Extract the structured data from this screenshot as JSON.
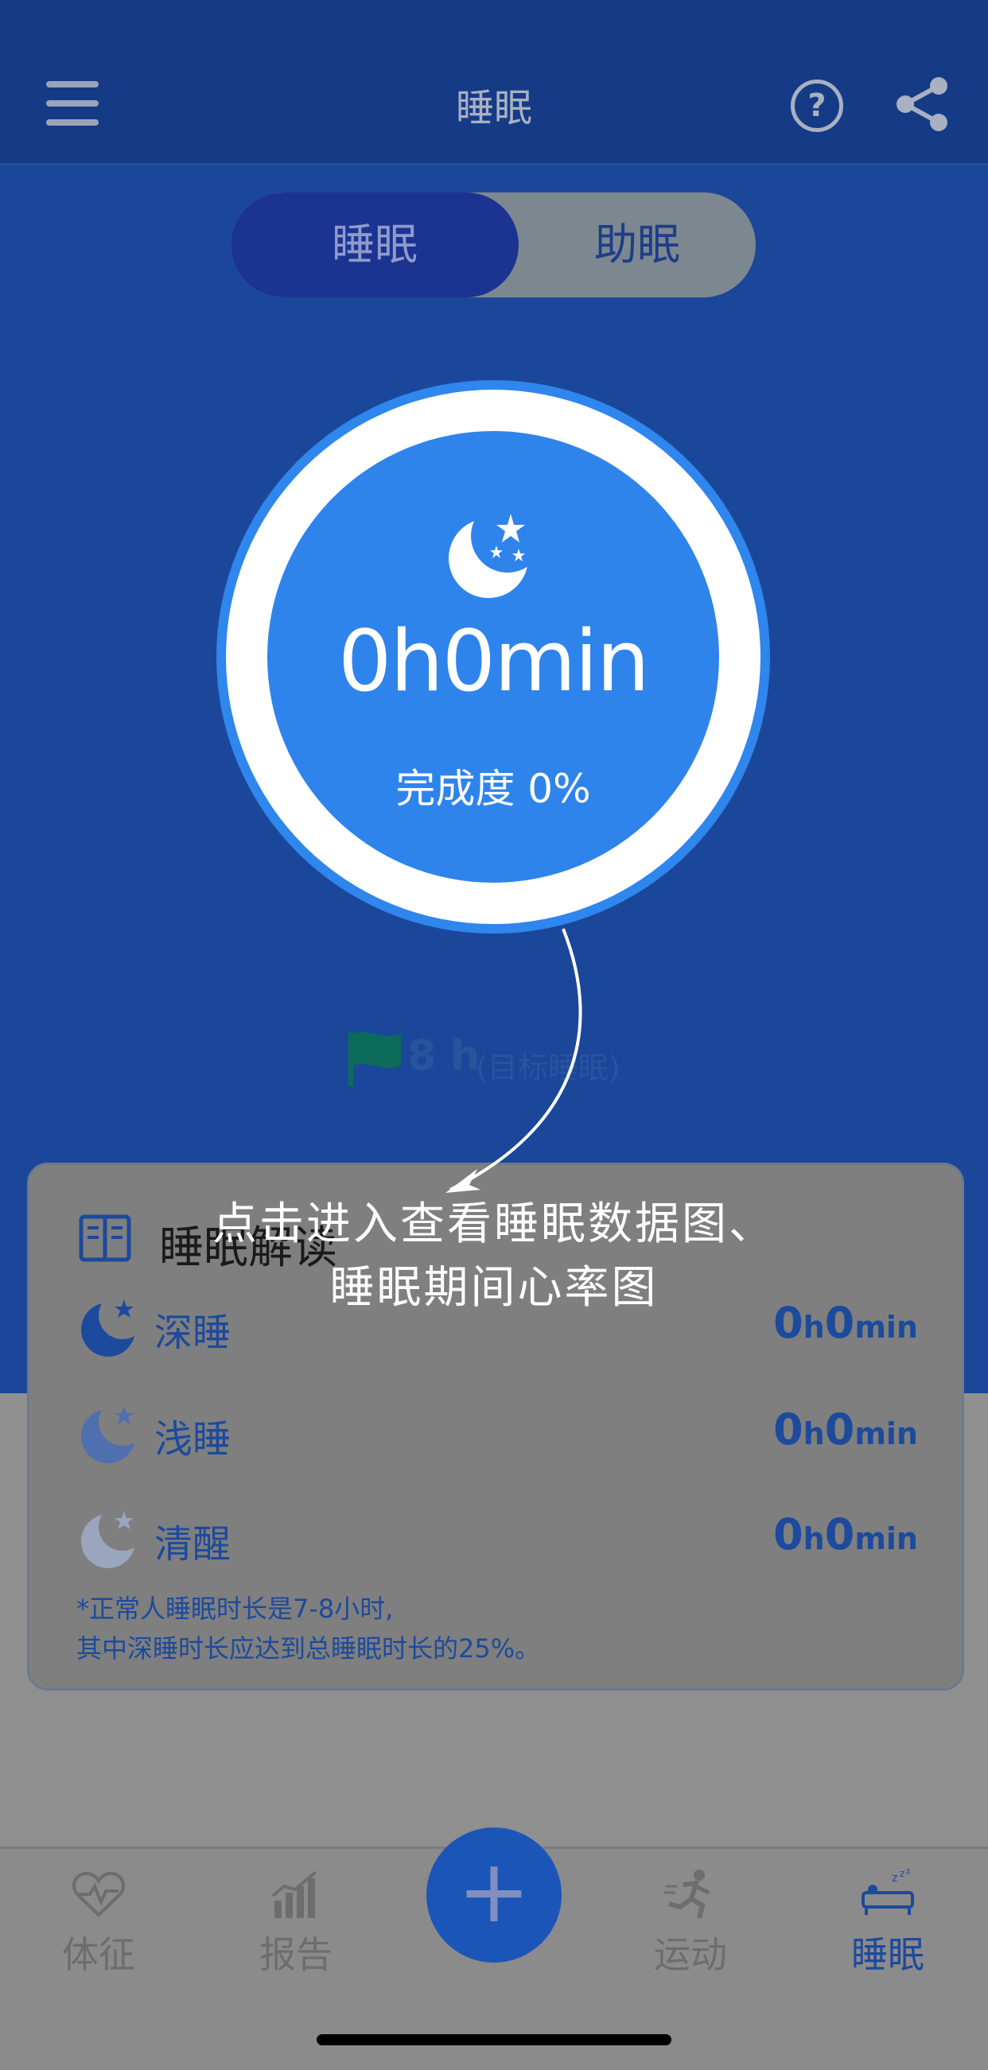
{
  "header": {
    "title": "睡眠"
  },
  "segment": {
    "sleep": "睡眠",
    "assist": "助眠"
  },
  "ring": {
    "sleep_time": "0h0min",
    "completion": "完成度 0%"
  },
  "goal": {
    "hours": "8 h",
    "label": "(目标睡眠)"
  },
  "card": {
    "title": "睡眠解读",
    "rows": [
      {
        "label": "深睡",
        "value_num1": "0",
        "value_h": "h",
        "value_num2": "0",
        "value_min": "min"
      },
      {
        "label": "浅睡",
        "value_num1": "0",
        "value_h": "h",
        "value_num2": "0",
        "value_min": "min"
      },
      {
        "label": "清醒",
        "value_num1": "0",
        "value_h": "h",
        "value_num2": "0",
        "value_min": "min"
      }
    ],
    "note_line1": "*正常人睡眠时长是7-8小时,",
    "note_line2": " 其中深睡时长应达到总睡眠时长的25%。"
  },
  "overlay": {
    "line1": "点击进入查看睡眠数据图、",
    "line2": "睡眠期间心率图"
  },
  "tabbar": {
    "tabs": [
      {
        "label": "体征",
        "icon": "heart-pulse-icon"
      },
      {
        "label": "报告",
        "icon": "bar-chart-icon"
      },
      {
        "label": "运动",
        "icon": "running-icon"
      },
      {
        "label": "睡眠",
        "icon": "bed-icon"
      }
    ],
    "add_label": "+"
  },
  "colors": {
    "primary": "#2f84ec",
    "header": "#153b86",
    "accent": "#1c4a9c"
  }
}
